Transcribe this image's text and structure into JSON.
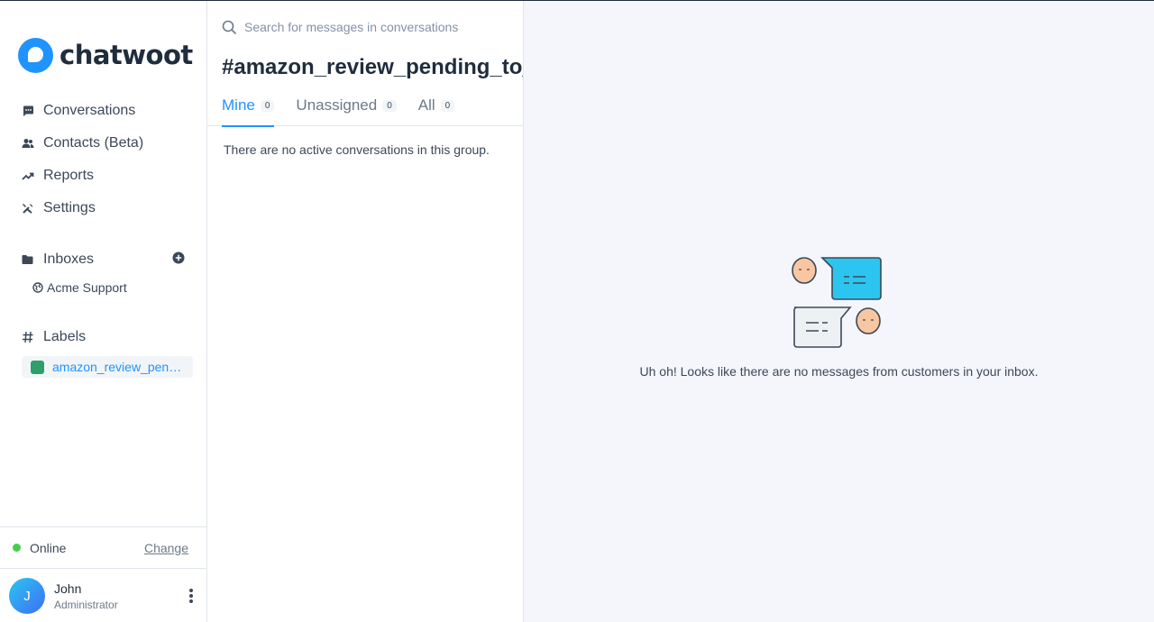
{
  "brand": {
    "name": "chatwoot"
  },
  "nav": {
    "items": [
      {
        "label": "Conversations",
        "icon": "chat-icon"
      },
      {
        "label": "Contacts (Beta)",
        "icon": "people-icon"
      },
      {
        "label": "Reports",
        "icon": "trend-icon"
      },
      {
        "label": "Settings",
        "icon": "tools-icon"
      }
    ]
  },
  "inboxes": {
    "heading": "Inboxes",
    "items": [
      {
        "label": "Acme Support",
        "icon": "globe-icon"
      }
    ]
  },
  "labels": {
    "heading": "Labels",
    "items": [
      {
        "label": "amazon_review_pending_to_be_sent",
        "color": "#2f9e6a"
      }
    ]
  },
  "status": {
    "label": "Online",
    "change_label": "Change",
    "color": "#44ce4b"
  },
  "profile": {
    "initial": "J",
    "name": "John",
    "role": "Administrator"
  },
  "conversations": {
    "search_placeholder": "Search for messages in conversations",
    "title": "#amazon_review_pending_to_be_sent",
    "tabs": [
      {
        "label": "Mine",
        "count": "0",
        "active": true
      },
      {
        "label": "Unassigned",
        "count": "0",
        "active": false
      },
      {
        "label": "All",
        "count": "0",
        "active": false
      }
    ],
    "empty_text": "There are no active conversations in this group."
  },
  "main": {
    "empty_text": "Uh oh! Looks like there are no messages from customers in your inbox."
  },
  "colors": {
    "accent": "#1f93ff",
    "bubble": "#2cc5f0"
  }
}
